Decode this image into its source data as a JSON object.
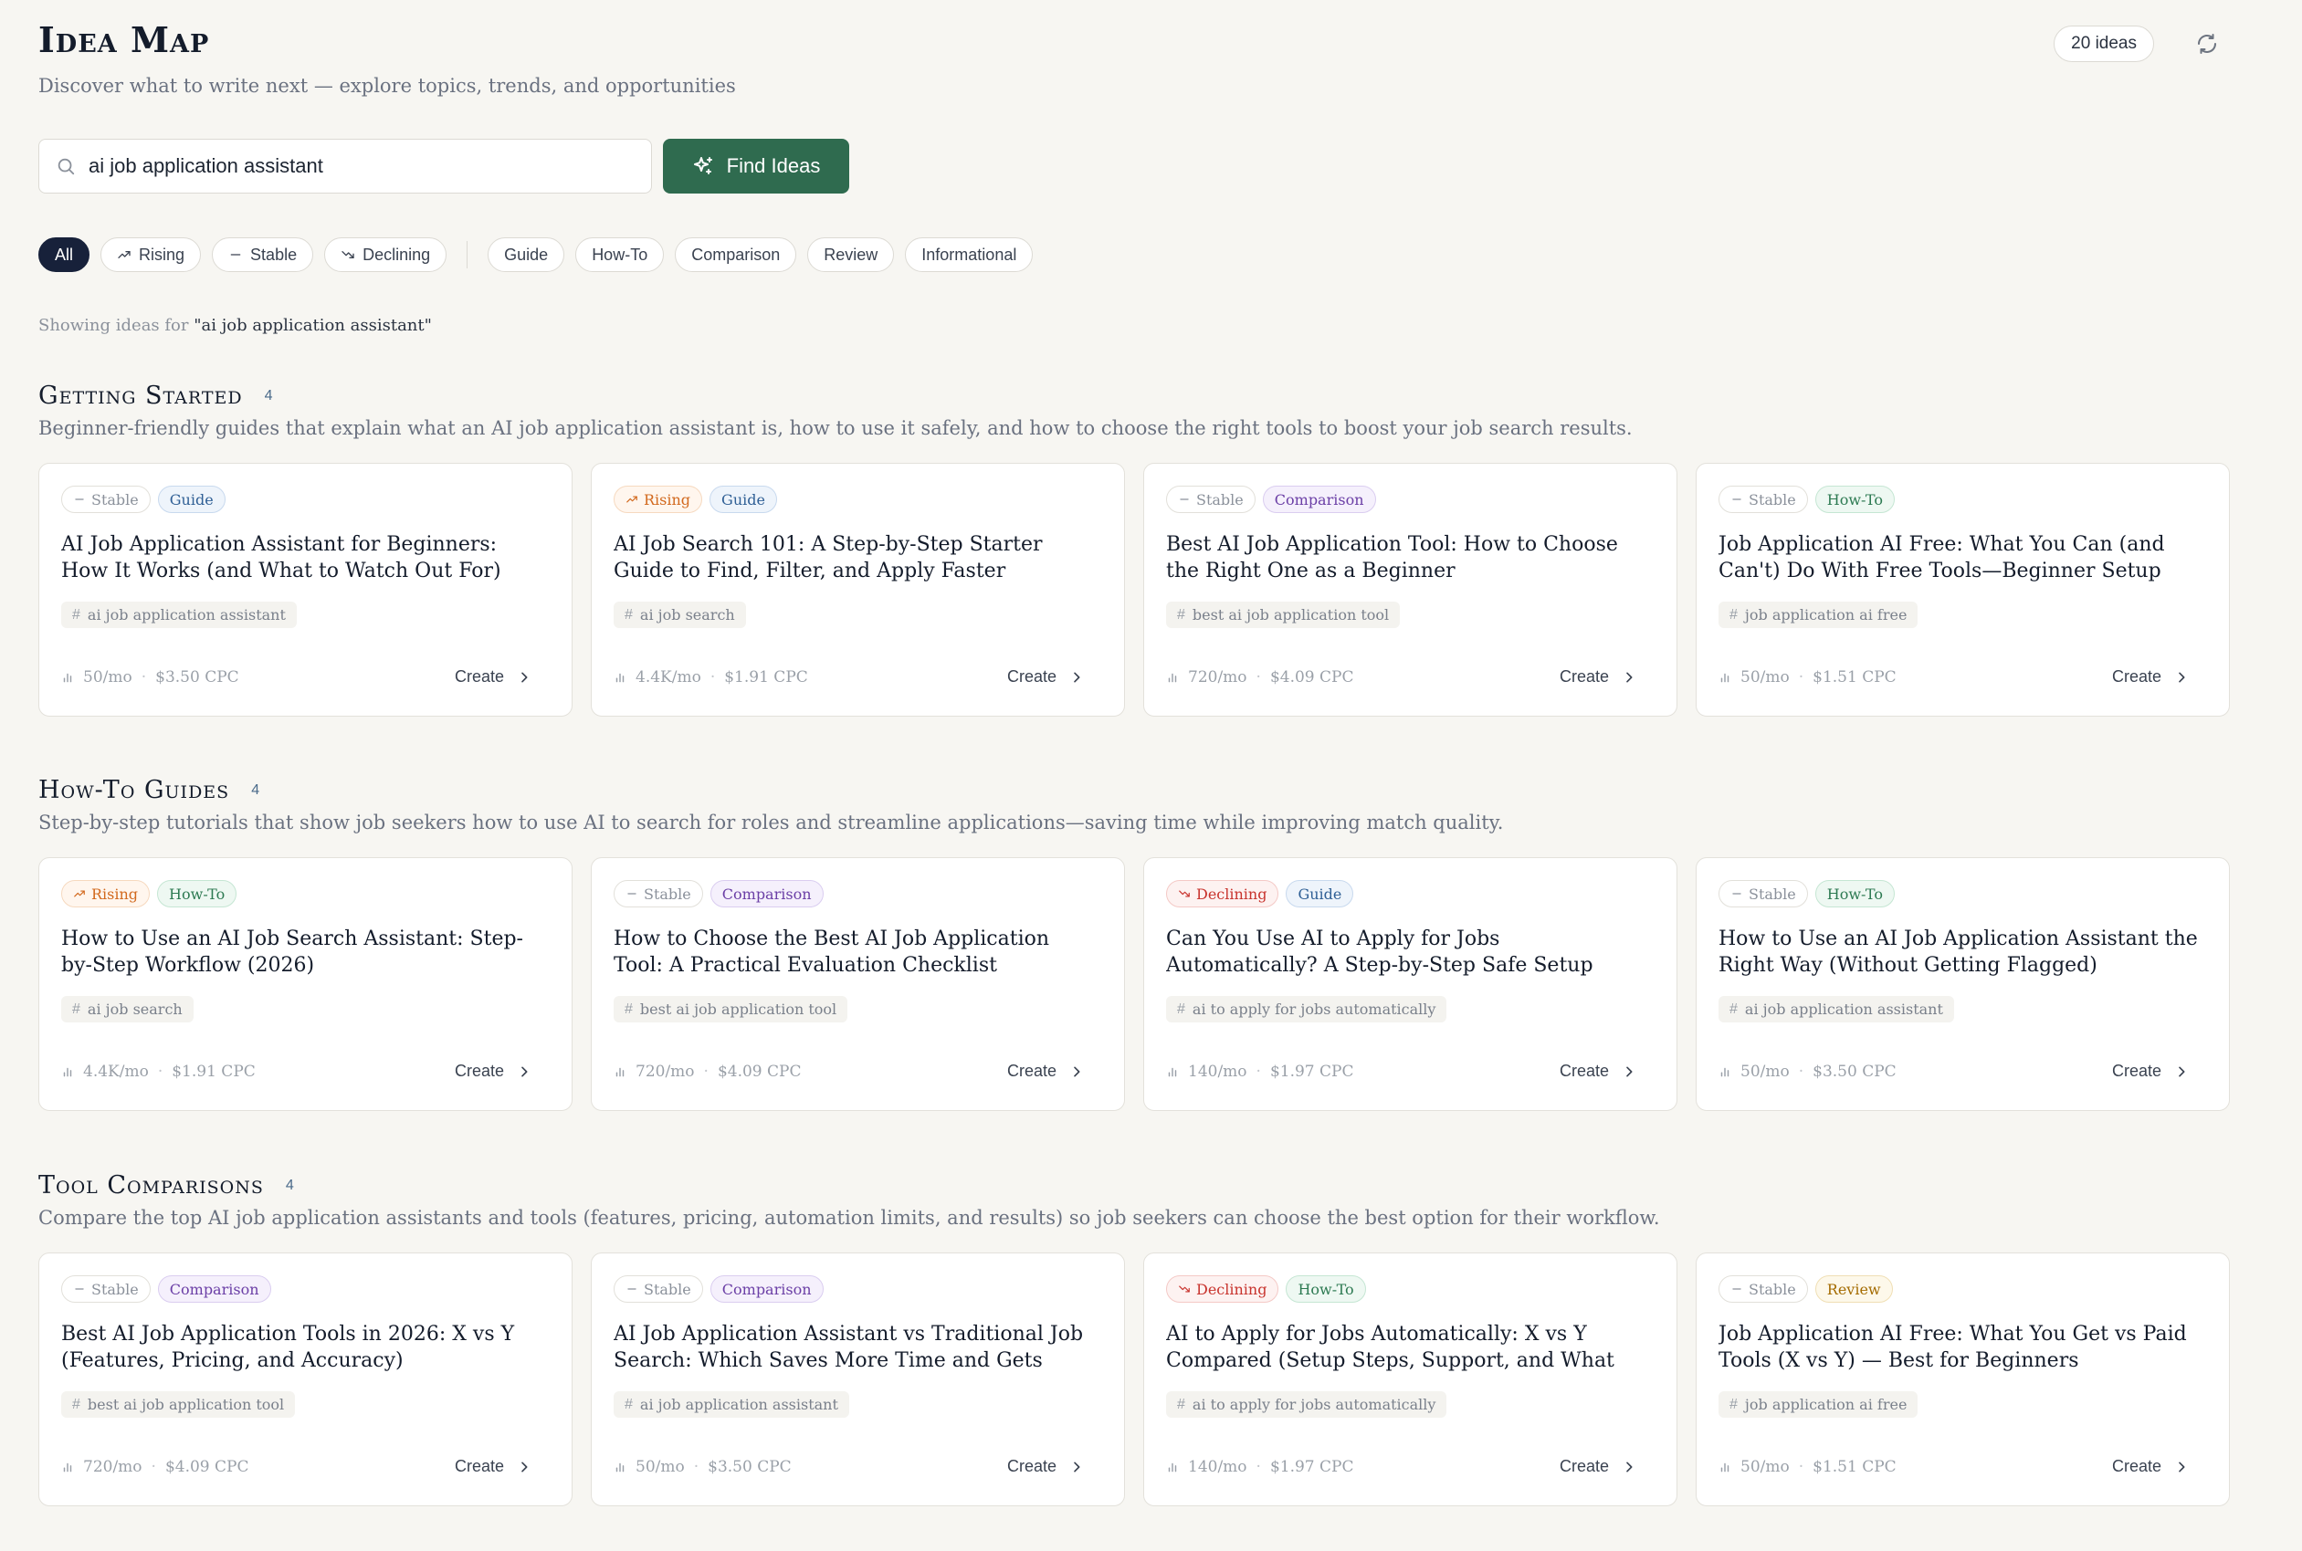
{
  "header": {
    "title": "Idea Map",
    "subtitle": "Discover what to write next — explore topics, trends, and opportunities",
    "count_label": "20 ideas"
  },
  "search": {
    "value": "ai job application assistant",
    "button_label": "Find Ideas"
  },
  "filters": {
    "trend": [
      "All",
      "Rising",
      "Stable",
      "Declining"
    ],
    "type": [
      "Guide",
      "How-To",
      "Comparison",
      "Review",
      "Informational"
    ]
  },
  "showing": {
    "prefix": "Showing ideas for",
    "query": "\"ai job application assistant\""
  },
  "create_label": "Create",
  "sections": [
    {
      "title": "Getting Started",
      "count": "4",
      "description": "Beginner-friendly guides that explain what an AI job application assistant is, how to use it safely, and how to choose the right tools to boost your job search results.",
      "cards": [
        {
          "trend": "Stable",
          "type": "Guide",
          "title": "AI Job Application Assistant for Beginners: How It Works (and What to Watch Out For)",
          "keyword": "ai job application assistant",
          "volume": "50/mo",
          "cpc": "$3.50 CPC"
        },
        {
          "trend": "Rising",
          "type": "Guide",
          "title": "AI Job Search 101: A Step-by-Step Starter Guide to Find, Filter, and Apply Faster",
          "keyword": "ai job search",
          "volume": "4.4K/mo",
          "cpc": "$1.91 CPC"
        },
        {
          "trend": "Stable",
          "type": "Comparison",
          "title": "Best AI Job Application Tool: How to Choose the Right One as a Beginner",
          "keyword": "best ai job application tool",
          "volume": "720/mo",
          "cpc": "$4.09 CPC"
        },
        {
          "trend": "Stable",
          "type": "How-To",
          "title": "Job Application AI Free: What You Can (and Can't) Do With Free Tools—Beginner Setup Guide",
          "keyword": "job application ai free",
          "volume": "50/mo",
          "cpc": "$1.51 CPC"
        }
      ]
    },
    {
      "title": "How-To Guides",
      "count": "4",
      "description": "Step-by-step tutorials that show job seekers how to use AI to search for roles and streamline applications—saving time while improving match quality.",
      "cards": [
        {
          "trend": "Rising",
          "type": "How-To",
          "title": "How to Use an AI Job Search Assistant: Step-by-Step Workflow (2026)",
          "keyword": "ai job search",
          "volume": "4.4K/mo",
          "cpc": "$1.91 CPC"
        },
        {
          "trend": "Stable",
          "type": "Comparison",
          "title": "How to Choose the Best AI Job Application Tool: A Practical Evaluation Checklist",
          "keyword": "best ai job application tool",
          "volume": "720/mo",
          "cpc": "$4.09 CPC"
        },
        {
          "trend": "Declining",
          "type": "Guide",
          "title": "Can You Use AI to Apply for Jobs Automatically? A Step-by-Step Safe Setup Guide",
          "keyword": "ai to apply for jobs automatically",
          "volume": "140/mo",
          "cpc": "$1.97 CPC"
        },
        {
          "trend": "Stable",
          "type": "How-To",
          "title": "How to Use an AI Job Application Assistant the Right Way (Without Getting Flagged)",
          "keyword": "ai job application assistant",
          "volume": "50/mo",
          "cpc": "$3.50 CPC"
        }
      ]
    },
    {
      "title": "Tool Comparisons",
      "count": "4",
      "description": "Compare the top AI job application assistants and tools (features, pricing, automation limits, and results) so job seekers can choose the best option for their workflow.",
      "cards": [
        {
          "trend": "Stable",
          "type": "Comparison",
          "title": "Best AI Job Application Tools in 2026: X vs Y (Features, Pricing, and Accuracy)",
          "keyword": "best ai job application tool",
          "volume": "720/mo",
          "cpc": "$4.09 CPC"
        },
        {
          "trend": "Stable",
          "type": "Comparison",
          "title": "AI Job Application Assistant vs Traditional Job Search: Which Saves More Time and Gets Better Replies? (X...",
          "keyword": "ai job application assistant",
          "volume": "50/mo",
          "cpc": "$3.50 CPC"
        },
        {
          "trend": "Declining",
          "type": "How-To",
          "title": "AI to Apply for Jobs Automatically: X vs Y Compared (Setup Steps, Support, and What Actually Gets...",
          "keyword": "ai to apply for jobs automatically",
          "volume": "140/mo",
          "cpc": "$1.97 CPC"
        },
        {
          "trend": "Stable",
          "type": "Review",
          "title": "Job Application AI Free: What You Get vs Paid Tools (X vs Y) — Best for Beginners",
          "keyword": "job application ai free",
          "volume": "50/mo",
          "cpc": "$1.51 CPC"
        }
      ]
    }
  ]
}
